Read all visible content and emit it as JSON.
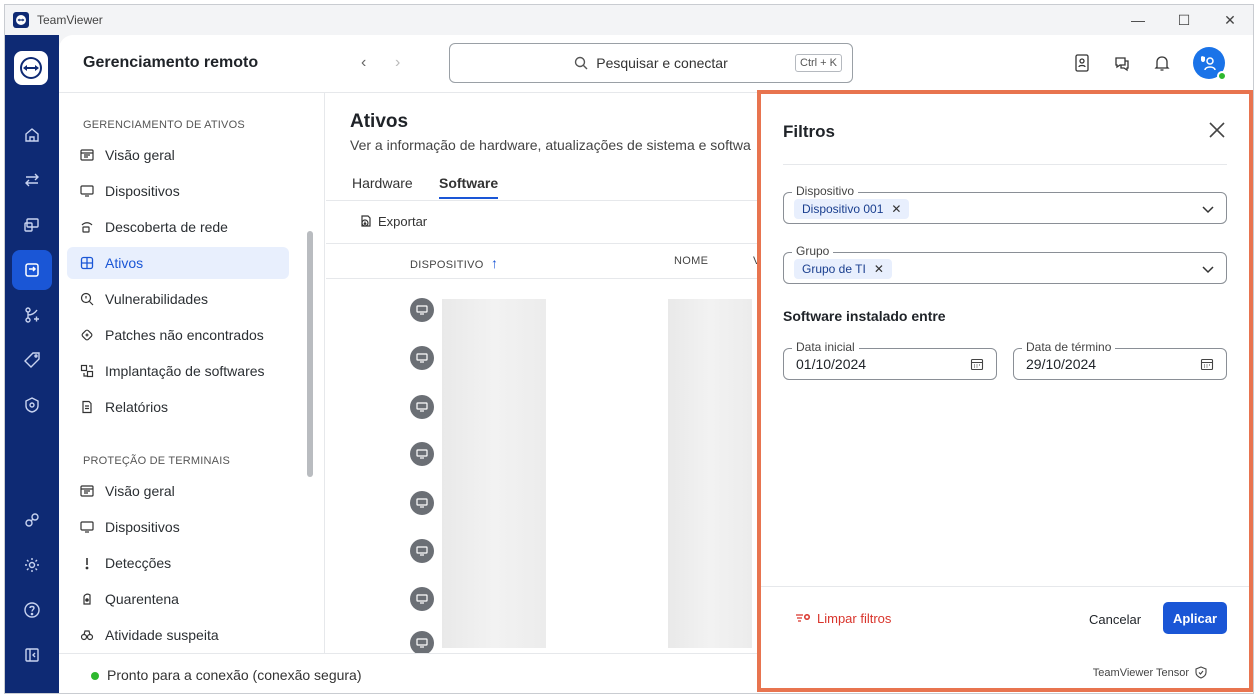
{
  "window": {
    "title": "TeamViewer",
    "min": "—",
    "max": "☐",
    "close": "✕"
  },
  "header": {
    "title": "Gerenciamento remoto",
    "back": "‹",
    "forward": "›",
    "search_placeholder": "Pesquisar e conectar",
    "search_shortcut": "Ctrl + K"
  },
  "sidebar": {
    "section1": "GERENCIAMENTO DE ATIVOS",
    "items1": [
      "Visão geral",
      "Dispositivos",
      "Descoberta de rede",
      "Ativos",
      "Vulnerabilidades",
      "Patches não encontrados",
      "Implantação de softwares",
      "Relatórios"
    ],
    "section2": "PROTEÇÃO DE TERMINAIS",
    "items2": [
      "Visão geral",
      "Dispositivos",
      "Detecções",
      "Quarentena",
      "Atividade suspeita"
    ]
  },
  "status": {
    "text": "Pronto para a conexão (conexão segura)"
  },
  "content": {
    "title": "Ativos",
    "subtitle": "Ver a informação de hardware, atualizações de sistema e softwa",
    "tabs": [
      "Hardware",
      "Software"
    ],
    "export": "Exportar",
    "columns": {
      "device": "DISPOSITIVO",
      "device_sort": "↑",
      "name": "NOME",
      "v": "V"
    }
  },
  "filters": {
    "title": "Filtros",
    "device_label": "Dispositivo",
    "device_chip": "Dispositivo 001",
    "group_label": "Grupo",
    "group_chip": "Grupo de TI",
    "chip_remove": "✕",
    "section": "Software instalado entre",
    "start_label": "Data inicial",
    "start_value": "01/10/2024",
    "end_label": "Data de término",
    "end_value": "29/10/2024",
    "clear": "Limpar filtros",
    "cancel": "Cancelar",
    "apply": "Aplicar",
    "footer": "TeamViewer Tensor"
  },
  "colors": {
    "accent": "#1a56d6",
    "rail": "#0e2a74",
    "highlight": "#e8744f",
    "danger": "#d9342b"
  }
}
